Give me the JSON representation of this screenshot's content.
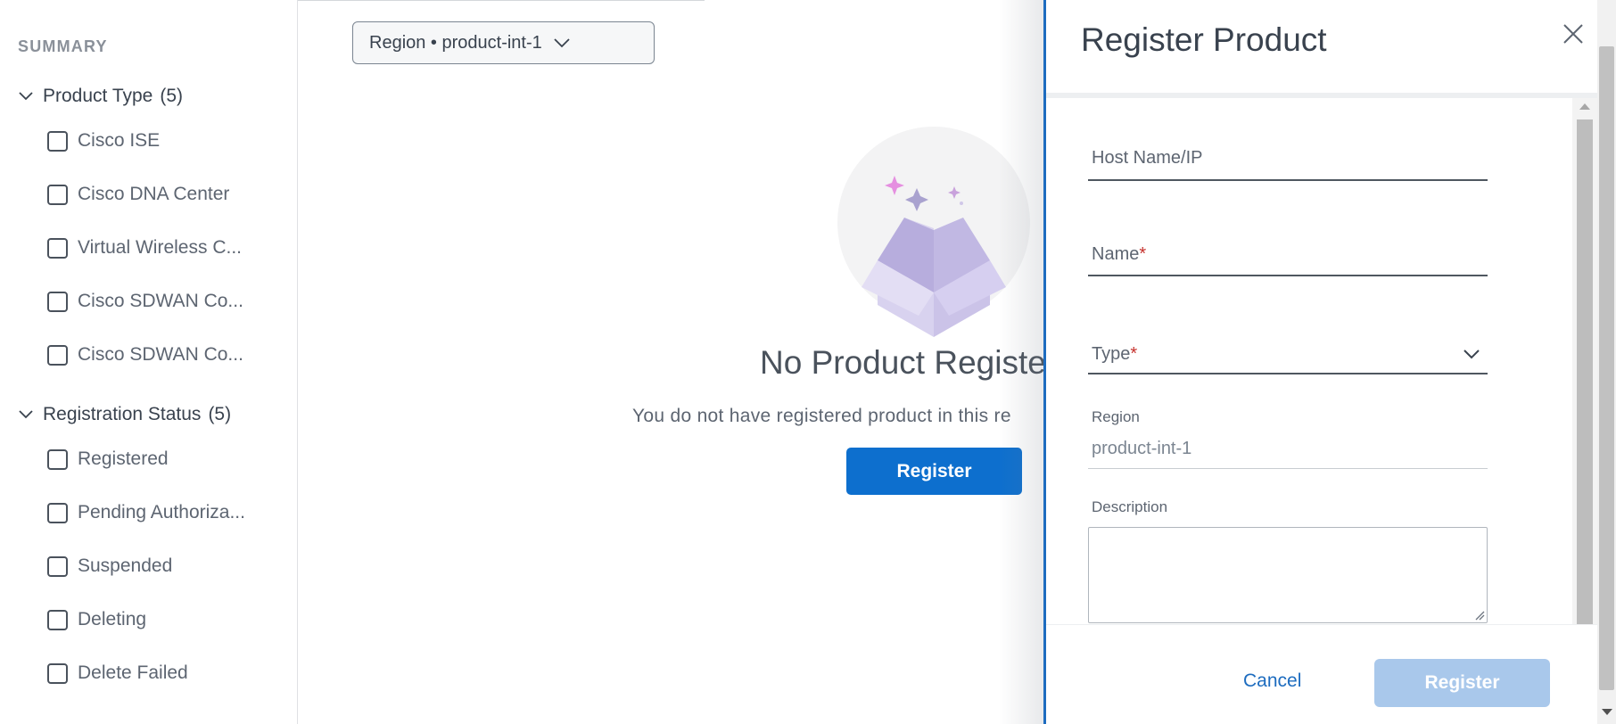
{
  "sidebar": {
    "title": "SUMMARY",
    "groups": [
      {
        "label": "Product Type",
        "count": "(5)",
        "items": [
          {
            "label": "Cisco ISE"
          },
          {
            "label": "Cisco DNA Center"
          },
          {
            "label": "Virtual Wireless C..."
          },
          {
            "label": "Cisco SDWAN Co..."
          },
          {
            "label": "Cisco SDWAN Co..."
          }
        ]
      },
      {
        "label": "Registration Status",
        "count": "(5)",
        "items": [
          {
            "label": "Registered"
          },
          {
            "label": "Pending Authoriza..."
          },
          {
            "label": "Suspended"
          },
          {
            "label": "Deleting"
          },
          {
            "label": "Delete Failed"
          }
        ]
      }
    ]
  },
  "main": {
    "region_selector": "Region • product-int-1",
    "empty_title": "No Product Registe",
    "empty_subtitle": "You do not have registered product in this re",
    "register_button": "Register",
    "illustration": "empty-box-icon"
  },
  "drawer": {
    "title": "Register Product",
    "close_icon": "close-icon",
    "fields": {
      "host": {
        "placeholder": "Host Name/IP",
        "value": ""
      },
      "name": {
        "placeholder": "Name",
        "required_mark": "*",
        "value": ""
      },
      "type": {
        "placeholder": "Type",
        "required_mark": "*",
        "value": ""
      },
      "region": {
        "label": "Region",
        "value": "product-int-1"
      },
      "description": {
        "label": "Description",
        "value": ""
      }
    },
    "footer": {
      "cancel_label": "Cancel",
      "register_label": "Register"
    }
  },
  "colors": {
    "accent": "#0d6fce",
    "drawer_border": "#1d6cbf",
    "disabled_button": "#a9c8eb",
    "required": "#c6322e",
    "text": "#39424e"
  }
}
